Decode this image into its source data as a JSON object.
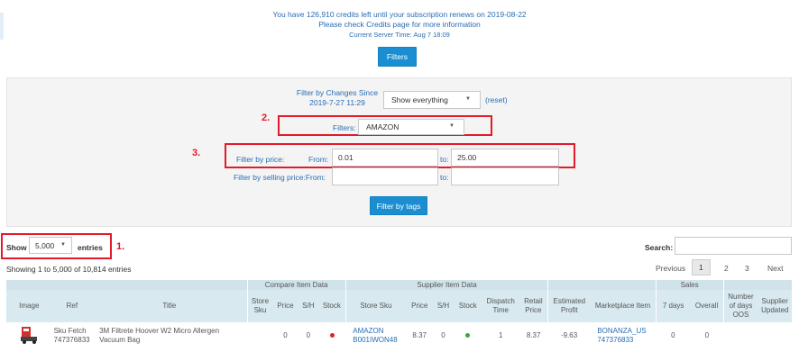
{
  "notice": {
    "line1": "You have 126,910 credits left until your subscription renews on 2019-08-22",
    "line2": "Please check Credits page for more information",
    "line3": "Current Server Time: Aug 7 18:09"
  },
  "filters_button": "Filters",
  "panel": {
    "changes_label": "Filter by Changes Since",
    "changes_date": "2019-7-27 11:29",
    "changes_select": "Show everything",
    "reset_link": "(reset)",
    "filters_label": "Filters:",
    "filters_select": "AMAZON",
    "price_label": "Filter by price:",
    "from_label": "From:",
    "price_from": "0.01",
    "to_label": "to:",
    "price_to": "25.00",
    "selling_label": "Filter by selling price:From:",
    "selling_to_label": "to:",
    "tags_button": "Filter by tags"
  },
  "annotations": {
    "a1": "1.",
    "a2": "2.",
    "a3": "3."
  },
  "length": {
    "show": "Show",
    "value": "5,000",
    "entries": "entries"
  },
  "info": "Showing 1 to 5,000 of 10,814 entries",
  "search_label": "Search:",
  "pagination": {
    "previous": "Previous",
    "p1": "1",
    "p2": "2",
    "p3": "3",
    "next": "Next"
  },
  "table": {
    "groups": {
      "compare": "Compare Item Data",
      "supplier": "Supplier Item Data",
      "sales": "Sales"
    },
    "headers": {
      "image": "Image",
      "ref": "Ref",
      "title": "Title",
      "store_sku": "Store Sku",
      "price": "Price",
      "sh": "S/H",
      "stock": "Stock",
      "s_store_sku": "Store Sku",
      "s_price": "Price",
      "s_sh": "S/H",
      "s_stock": "Stock",
      "dispatch": "Dispatch Time",
      "retail": "Retail Price",
      "profit": "Estimated Profit",
      "marketplace": "Marketplace Item",
      "d7": "7 days",
      "overall": "Overall",
      "oos": "Number of days OOS",
      "updated": "Supplier Updated"
    },
    "row": {
      "ref1": "Sku Fetch",
      "ref2": "747376833",
      "title1": "3M Filtrete Hoover W2 Micro Allergen",
      "title2": "Vacuum Bag",
      "price": "0",
      "sh": "0",
      "s_store1": "AMAZON",
      "s_store2": "B001IWON48",
      "s_price": "8.37",
      "s_sh": "0",
      "dispatch": "1",
      "retail": "8.37",
      "profit": "-9.63",
      "mkt1": "BONANZA_US",
      "mkt2": "747376833",
      "d7": "0",
      "overall": "0"
    }
  },
  "colors": {
    "accent": "#1a8ed1",
    "annotation": "#e21a2a",
    "stock_red": "#e0202a",
    "stock_green": "#2fae3a"
  }
}
